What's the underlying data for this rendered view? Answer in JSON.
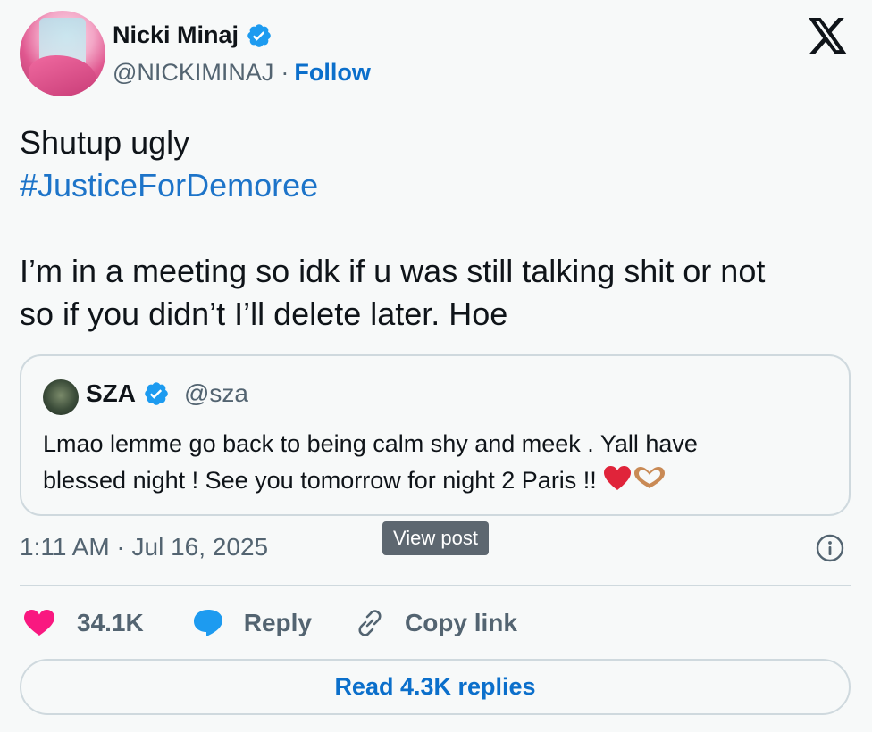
{
  "author": {
    "name": "Nicki Minaj",
    "handle": "@NICKIMINAJ",
    "separator": "·",
    "follow_label": "Follow"
  },
  "tweet": {
    "lines": [
      "Shutup ugly",
      "#JusticeForDemoree",
      "",
      "I’m in a meeting so idk if u was still talking shit or not",
      "so if you didn’t I’ll delete later. Hoe"
    ]
  },
  "quote": {
    "name": "SZA",
    "handle": "@sza",
    "lines": [
      "Lmao lemme go back to being calm shy and meek . Yall have",
      "blessed night ! See you tomorrow for night 2 Paris !!"
    ],
    "emojis": [
      "red-heart",
      "heart-hands"
    ]
  },
  "tooltip": "View post",
  "timestamp": "1:11 AM · Jul 16, 2025",
  "actions": {
    "likes": "34.1K",
    "reply_label": "Reply",
    "copy_link_label": "Copy link"
  },
  "read_replies_label": "Read 4.3K replies",
  "colors": {
    "accent": "#1d9bf0",
    "link": "#0b6fcb",
    "like": "#f91880",
    "muted": "#536471",
    "border": "#cfd9de",
    "background": "#f7f9f9"
  },
  "icons": [
    "verified-badge-icon",
    "x-logo-icon",
    "info-icon",
    "heart-icon",
    "reply-icon",
    "link-icon"
  ]
}
